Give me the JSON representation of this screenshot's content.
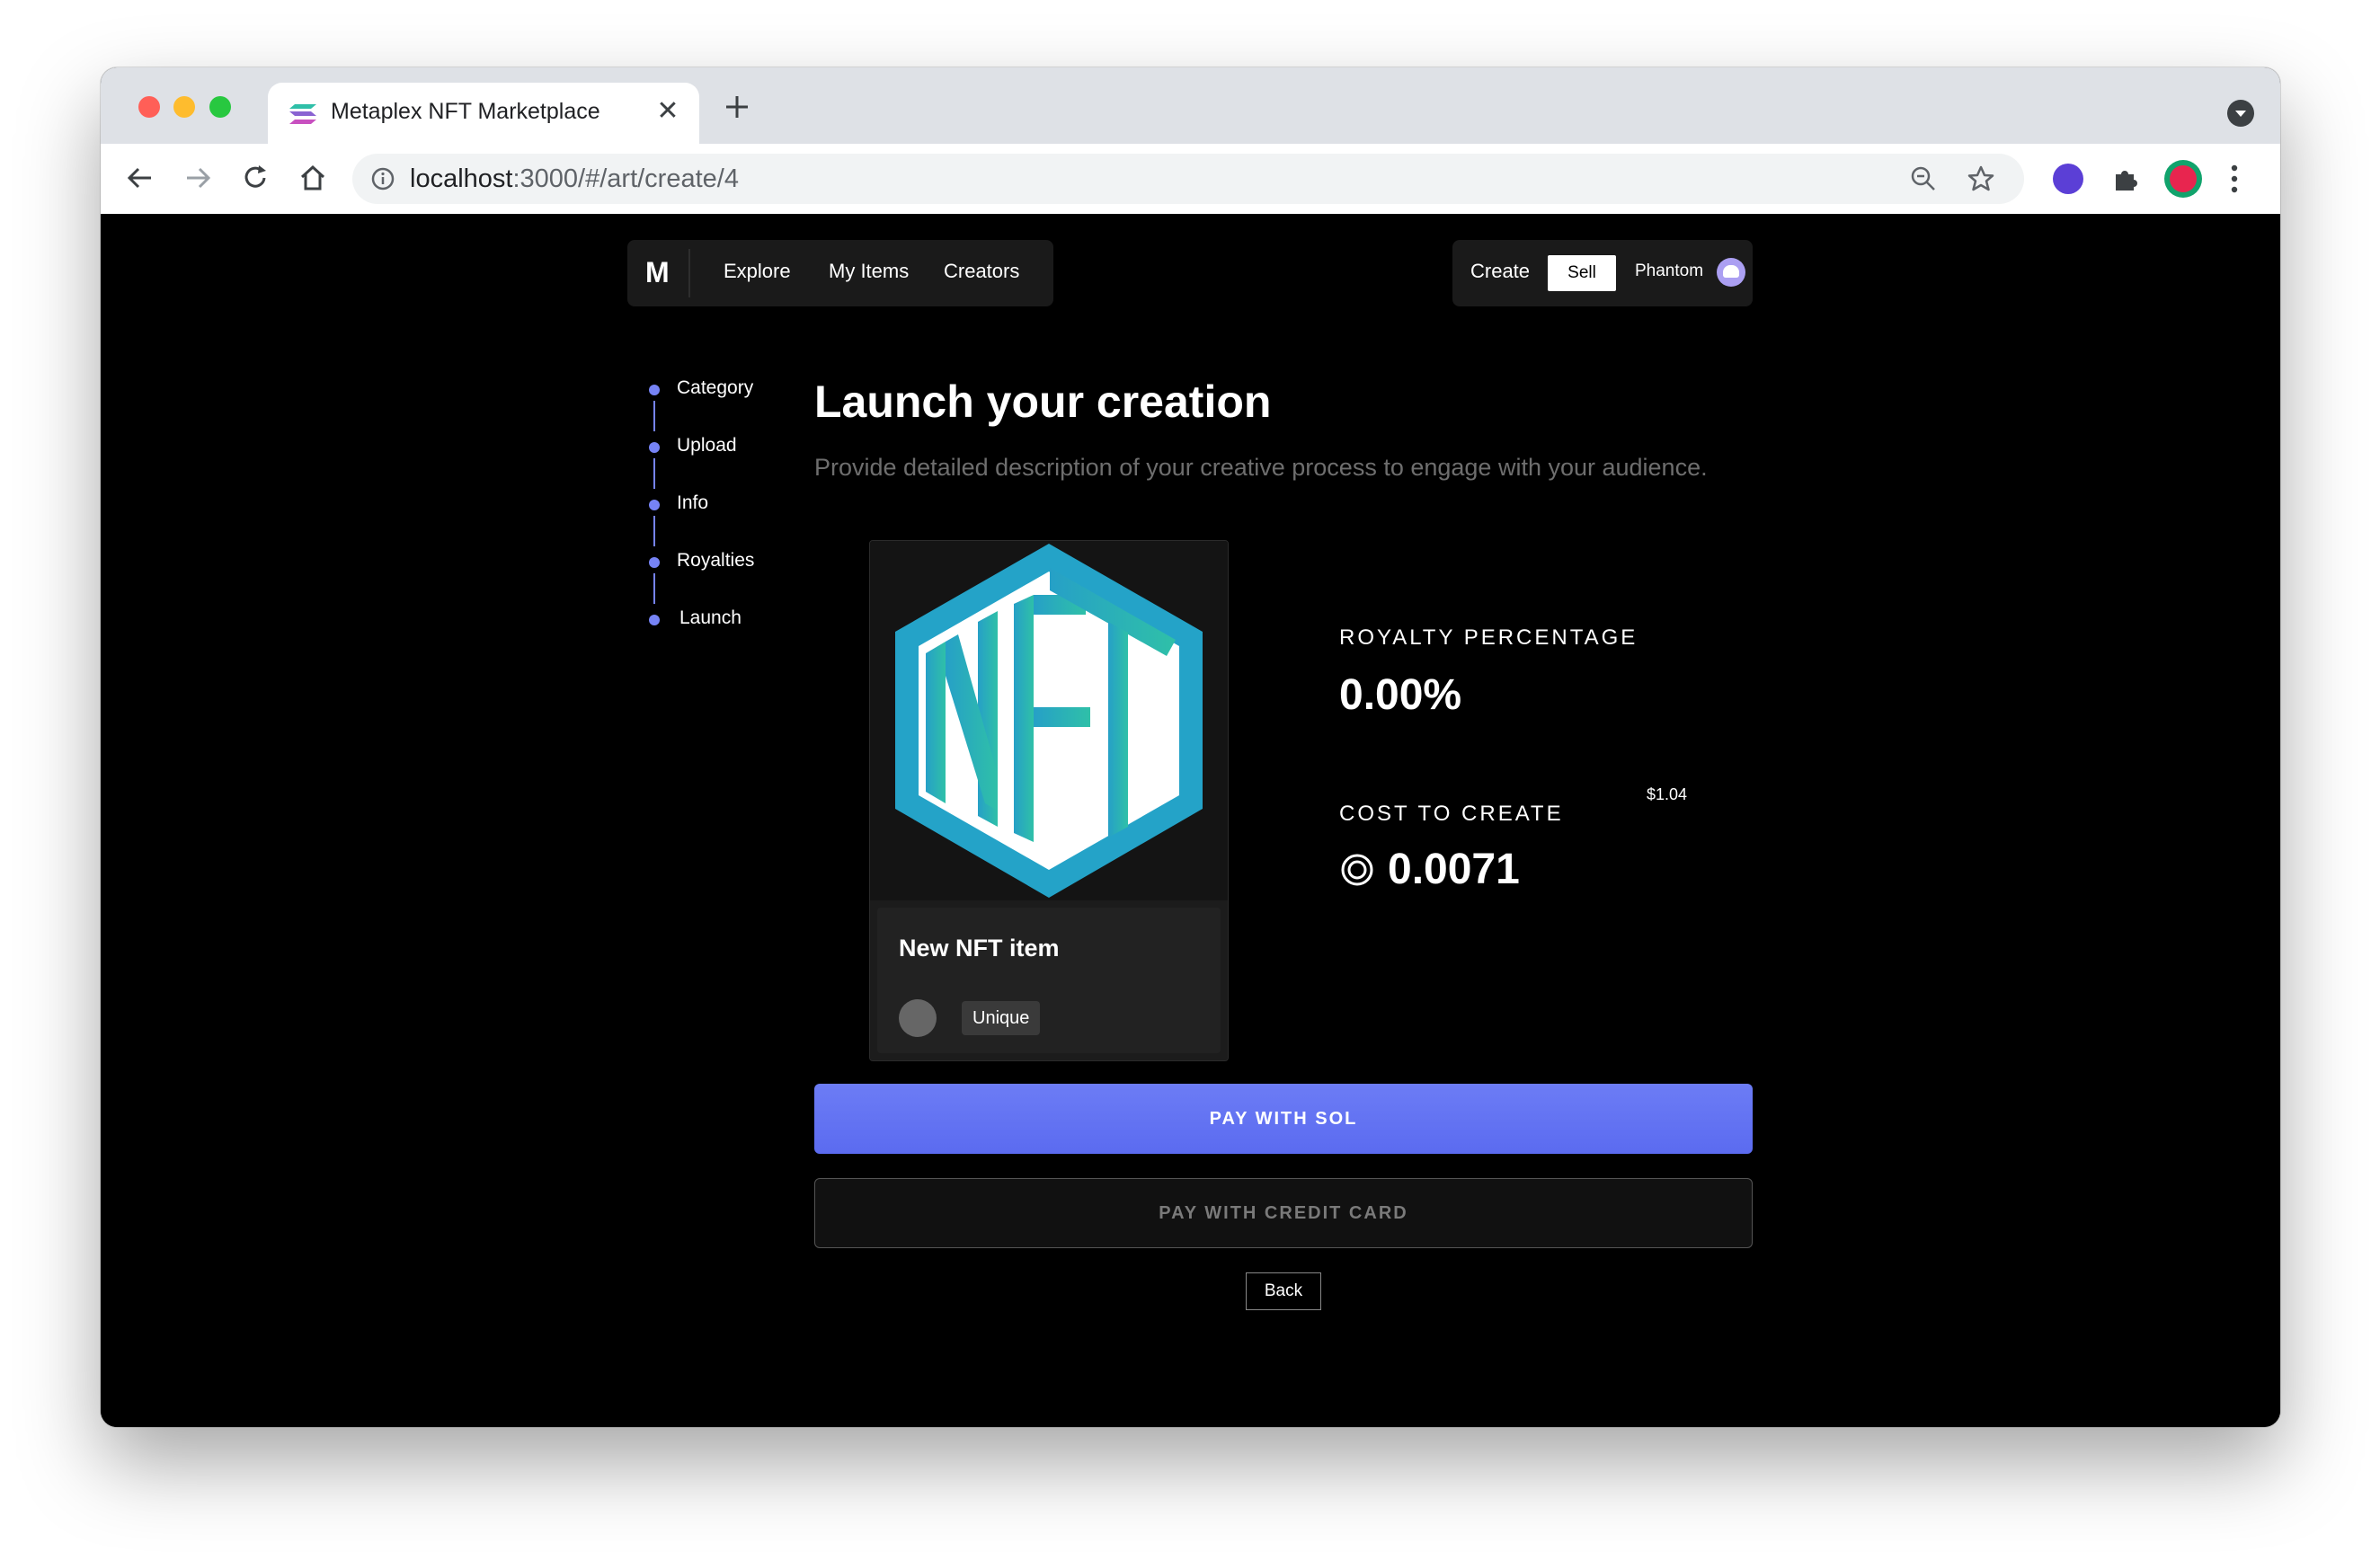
{
  "browser": {
    "tab_title": "Metaplex NFT Marketplace",
    "tab_close": "✕",
    "url_host": "localhost",
    "url_path": ":3000/#/art/create/4"
  },
  "nav": {
    "logo": "M",
    "links": [
      "Explore",
      "My Items",
      "Creators"
    ],
    "create_label": "Create",
    "sell_label": "Sell",
    "wallet_label": "Phantom"
  },
  "steps": [
    "Category",
    "Upload",
    "Info",
    "Royalties",
    "Launch"
  ],
  "header": {
    "title": "Launch your creation",
    "subtitle": "Provide detailed description of your creative process to engage with your audience."
  },
  "card": {
    "image_alt": "NFT logo",
    "title": "New NFT item",
    "badge": "Unique"
  },
  "royalty": {
    "label": "ROYALTY PERCENTAGE",
    "value": "0.00%"
  },
  "cost": {
    "label": "COST TO CREATE",
    "usd": "$1.04",
    "value": "0.0071"
  },
  "actions": {
    "pay_sol": "PAY WITH SOL",
    "pay_card": "PAY WITH CREDIT CARD",
    "back": "Back"
  },
  "colors": {
    "accent": "#6c7cf5",
    "step_color": "#7683f5",
    "nft_blue": "#24a3c8",
    "nft_teal": "#2fbfa8"
  },
  "icons": {
    "nav_back": "arrow-left-icon",
    "nav_forward": "arrow-right-icon",
    "reload": "reload-icon",
    "home": "home-icon",
    "info": "info-icon",
    "zoom": "zoom-icon",
    "bookmark": "star-icon",
    "extension": "puzzle-icon",
    "menu": "more-vert-icon",
    "sol": "sol-coin-icon"
  }
}
